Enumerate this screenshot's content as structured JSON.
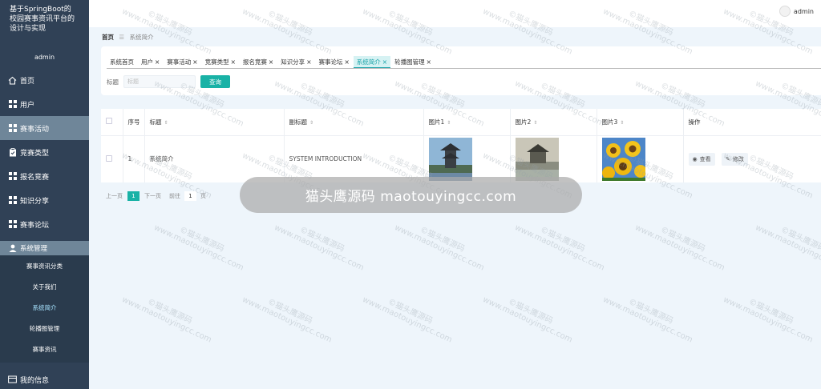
{
  "app": {
    "title_lines": [
      "基于SpringBoot的",
      "校园赛事资讯平台的",
      "设计与实现"
    ],
    "sidebar_user": "admin"
  },
  "sidebar": {
    "items": [
      {
        "label": "首页",
        "icon": "home-icon"
      },
      {
        "label": "用户",
        "icon": "grid-icon"
      },
      {
        "label": "赛事活动",
        "icon": "grid-icon"
      },
      {
        "label": "竞赛类型",
        "icon": "clipboard-icon"
      },
      {
        "label": "报名竞赛",
        "icon": "grid-icon"
      },
      {
        "label": "知识分享",
        "icon": "grid-icon"
      },
      {
        "label": "赛事论坛",
        "icon": "grid-icon"
      }
    ],
    "group": {
      "label": "系统管理",
      "icon": "user-icon"
    },
    "sub_items": [
      "赛事资讯分类",
      "关于我们",
      "系统简介",
      "轮播图管理",
      "赛事资讯"
    ],
    "bottom_item": {
      "label": "我的信息",
      "icon": "id-card-icon"
    }
  },
  "topbar": {
    "user": "admin"
  },
  "breadcrumb": {
    "home": "首页",
    "sep": "☰",
    "current": "系统简介"
  },
  "tabs": [
    {
      "label": "系统首页",
      "closable": false
    },
    {
      "label": "用户",
      "closable": true
    },
    {
      "label": "赛事活动",
      "closable": true
    },
    {
      "label": "竞赛类型",
      "closable": true
    },
    {
      "label": "报名竞赛",
      "closable": true
    },
    {
      "label": "知识分享",
      "closable": true
    },
    {
      "label": "赛事论坛",
      "closable": true
    },
    {
      "label": "系统简介",
      "closable": true
    },
    {
      "label": "轮播图管理",
      "closable": true
    }
  ],
  "search": {
    "label": "标题",
    "placeholder": "标题",
    "button": "查询"
  },
  "table": {
    "headers": [
      "序号",
      "标题",
      "副标题",
      "图片1",
      "图片2",
      "图片3",
      "操作"
    ],
    "rows": [
      {
        "index": "1",
        "title": "系统简介",
        "subtitle": "SYSTEM INTRODUCTION",
        "view": "查看",
        "edit": "修改"
      }
    ]
  },
  "pager": {
    "prev": "上一页",
    "current": "1",
    "next": "下一页",
    "goto": "前往",
    "goto_value": "1",
    "page_unit": "页"
  },
  "watermark": {
    "brand": "©猫头鹰源码",
    "url": "www.maotouyingcc.com"
  },
  "banner": "猫头鹰源码 maotouyingcc.com",
  "colors": {
    "sidebar": "#304156",
    "accent": "#19b2a6",
    "active_tab": "#d6f2f3"
  }
}
